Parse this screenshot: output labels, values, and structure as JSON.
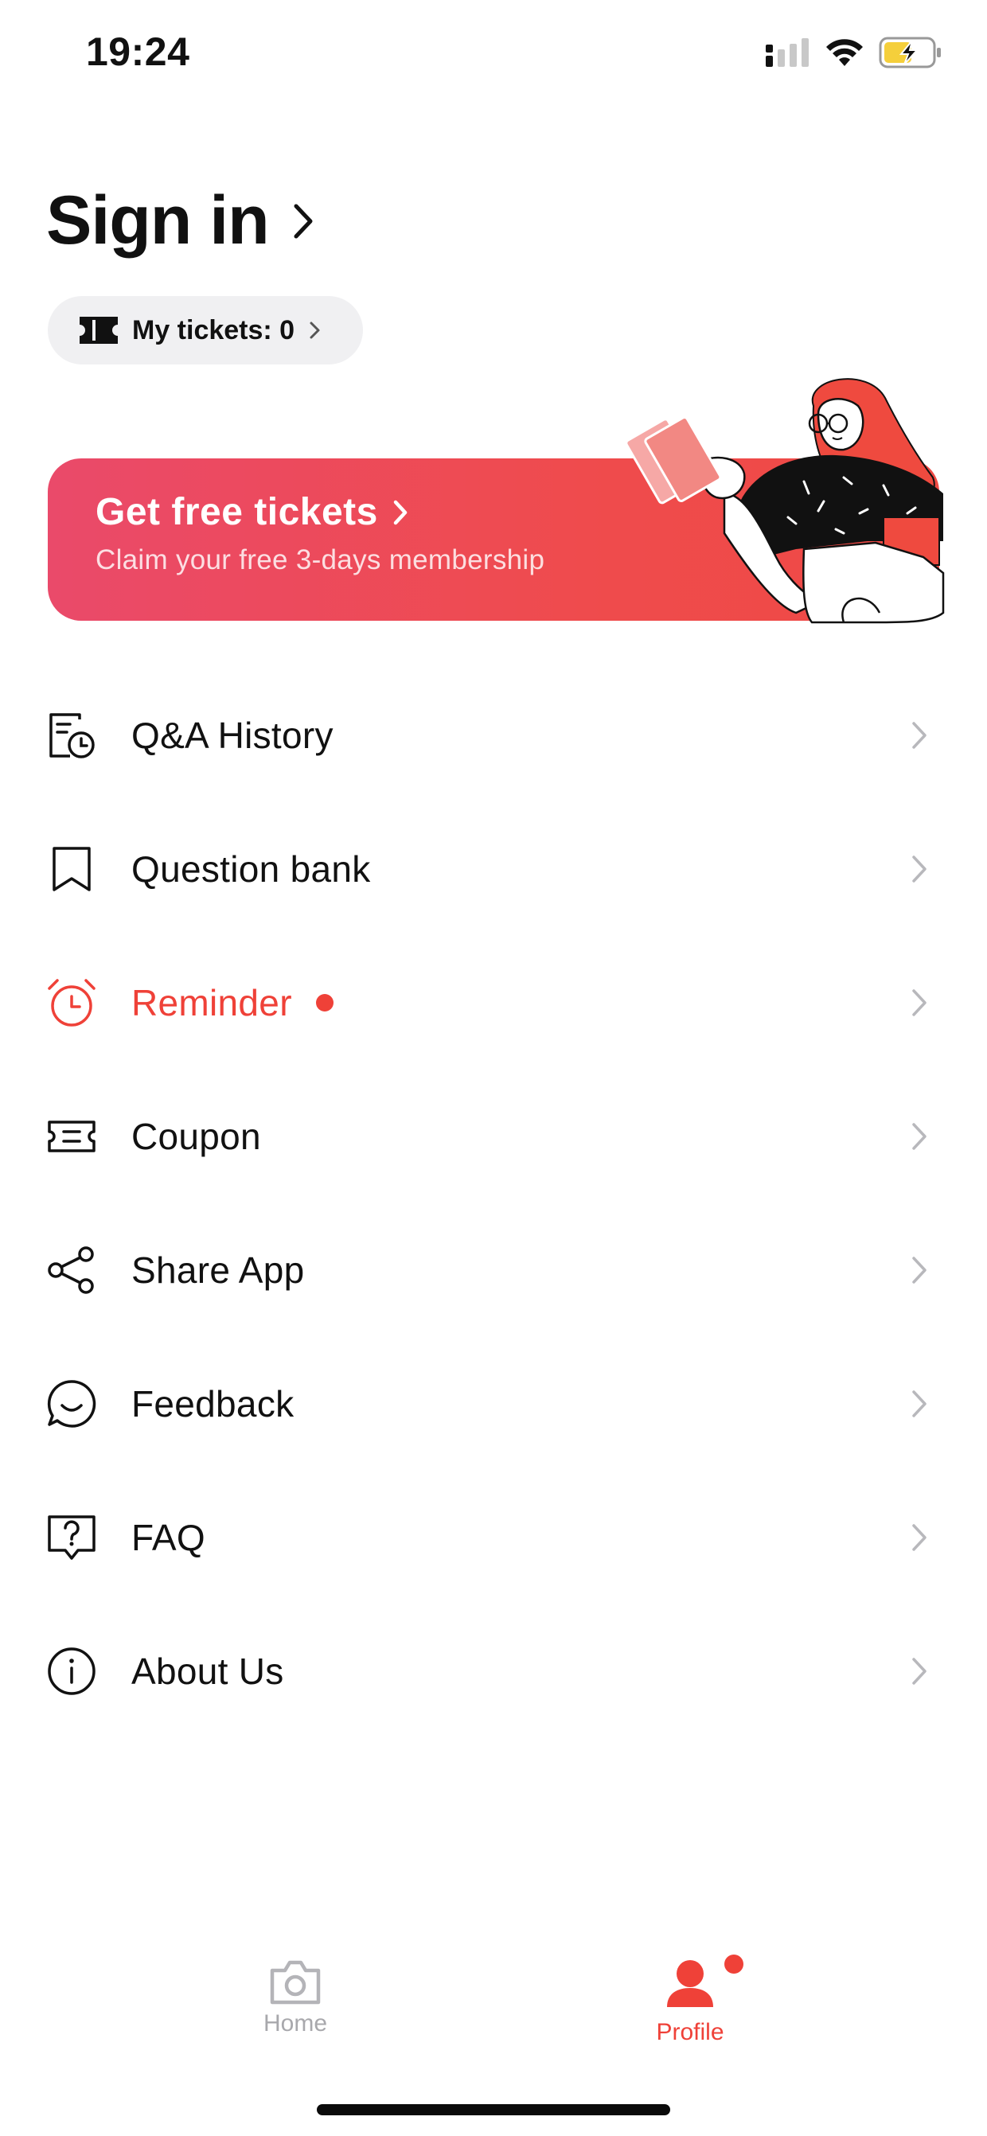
{
  "status_bar": {
    "time": "19:24"
  },
  "header": {
    "signin_label": "Sign in",
    "tickets_label": "My tickets: 0"
  },
  "banner": {
    "title": "Get free tickets",
    "subtitle": "Claim your free 3-days membership"
  },
  "menu": [
    {
      "label": "Q&A History",
      "icon": "history-document-icon"
    },
    {
      "label": "Question bank",
      "icon": "bookmark-icon"
    },
    {
      "label": "Reminder",
      "icon": "alarm-clock-icon",
      "highlighted": true,
      "has_dot": true
    },
    {
      "label": "Coupon",
      "icon": "coupon-icon"
    },
    {
      "label": "Share App",
      "icon": "share-icon"
    },
    {
      "label": "Feedback",
      "icon": "feedback-smile-icon"
    },
    {
      "label": "FAQ",
      "icon": "question-bubble-icon"
    },
    {
      "label": "About Us",
      "icon": "info-icon"
    }
  ],
  "tab_bar": {
    "home_label": "Home",
    "profile_label": "Profile",
    "active": "Profile"
  },
  "colors": {
    "accent": "#ef4138",
    "banner_start": "#ea4a6a",
    "banner_end": "#ef4a44",
    "inactive_tab": "#b4b4b8"
  }
}
